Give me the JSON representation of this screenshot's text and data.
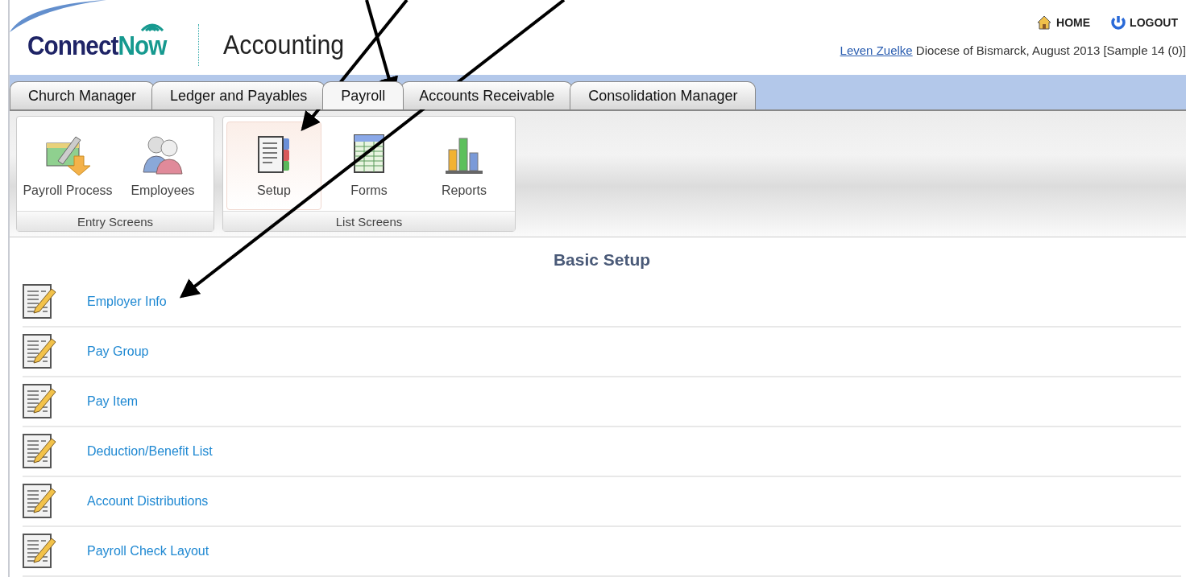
{
  "header": {
    "logo": {
      "first": "Connect",
      "second": "Now"
    },
    "title": "Accounting",
    "links": [
      {
        "kind": "home",
        "label": "HOME"
      },
      {
        "kind": "logout",
        "label": "LOGOUT"
      }
    ],
    "user": "Leven Zuelke",
    "context": "Diocese of Bismarck, August 2013 [Sample 14 (0)]"
  },
  "tabs": [
    {
      "label": "Church Manager",
      "selected": false
    },
    {
      "label": "Ledger and Payables",
      "selected": false
    },
    {
      "label": "Payroll",
      "selected": true
    },
    {
      "label": "Accounts Receivable",
      "selected": false
    },
    {
      "label": "Consolidation Manager",
      "selected": false
    }
  ],
  "ribbon_groups": [
    {
      "label": "Entry Screens",
      "buttons": [
        {
          "kind": "process",
          "label": "Payroll Process",
          "selected": false
        },
        {
          "kind": "people",
          "label": "Employees",
          "selected": false
        }
      ]
    },
    {
      "label": "List Screens",
      "buttons": [
        {
          "kind": "setup",
          "label": "Setup",
          "selected": true
        },
        {
          "kind": "forms",
          "label": "Forms",
          "selected": false
        },
        {
          "kind": "reports",
          "label": "Reports",
          "selected": false
        }
      ]
    }
  ],
  "content": {
    "title": "Basic Setup",
    "items": [
      "Employer Info",
      "Pay Group",
      "Pay Item",
      "Deduction/Benefit List",
      "Account Distributions",
      "Payroll Check Layout"
    ]
  }
}
